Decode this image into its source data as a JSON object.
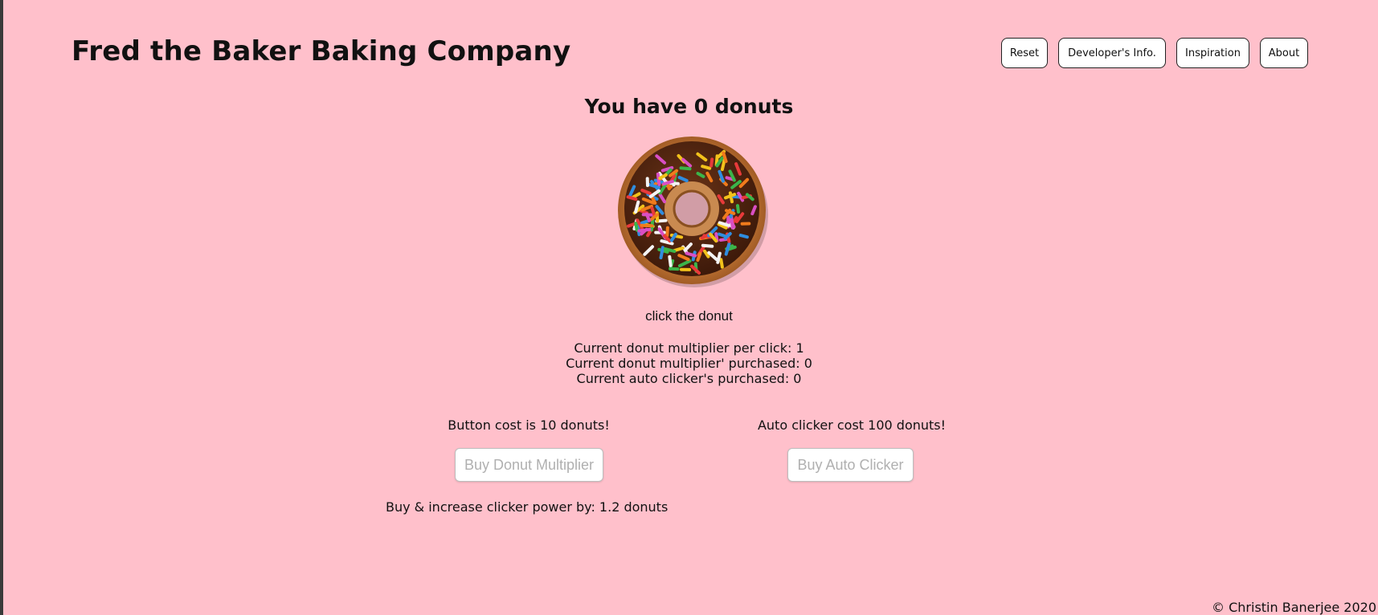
{
  "header": {
    "title": "Fred the Baker Baking Company",
    "nav": [
      {
        "label": "Reset"
      },
      {
        "label": "Developer's Info."
      },
      {
        "label": "Inspiration"
      },
      {
        "label": "About"
      }
    ]
  },
  "game": {
    "donut_count_text": "You have 0 donuts",
    "click_hint": "click the donut",
    "stats": {
      "multiplier_per_click": "Current donut multiplier per click: 1",
      "multipliers_purchased": "Current donut multiplier' purchased: 0",
      "auto_clickers_purchased": "Current auto clicker's purchased: 0"
    },
    "shop": {
      "multiplier_cost": "Button cost is 10 donuts!",
      "multiplier_button": "Buy Donut Multiplier",
      "multiplier_power": "Buy & increase clicker power by: 1.2 donuts",
      "autoclicker_cost": "Auto clicker cost 100 donuts!",
      "autoclicker_button": "Buy Auto Clicker"
    }
  },
  "footer": {
    "copyright": "© Christin Banerjee 2020"
  },
  "colors": {
    "background": "#ffc0cb",
    "button_border": "#222222",
    "disabled_text": "#b0b0b0"
  },
  "icons": {
    "donut": "donut-image"
  }
}
